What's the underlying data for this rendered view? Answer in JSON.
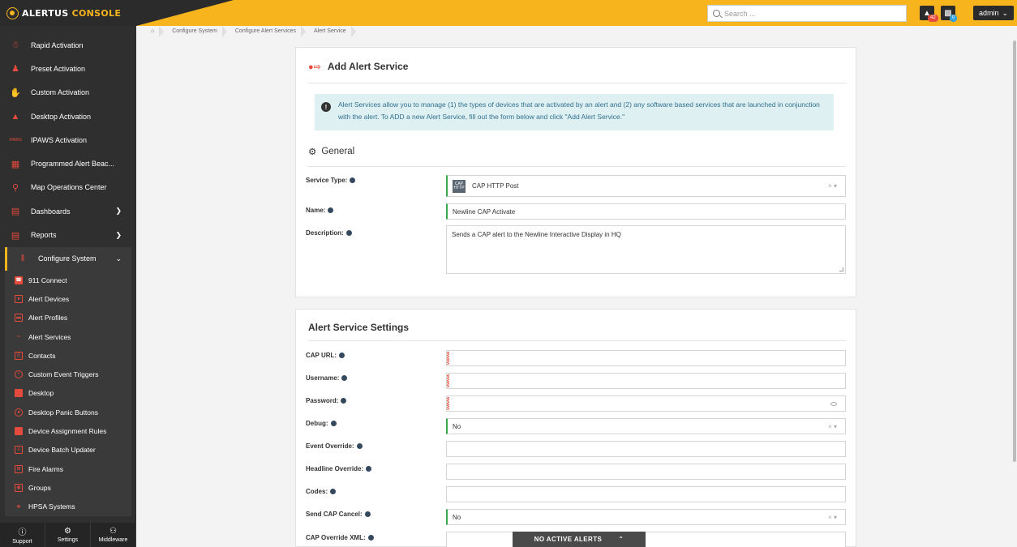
{
  "brand": {
    "name_a": "ALERTUS",
    "name_b": "CONSOLE"
  },
  "topbar": {
    "search_placeholder": "Search ...",
    "alerts_badge": "42",
    "users_badge": "0",
    "user_label": "admin"
  },
  "sidebar": {
    "items": [
      {
        "label": "Rapid Activation",
        "icon": "megaphone-icon"
      },
      {
        "label": "Preset Activation",
        "icon": "person-alert-icon"
      },
      {
        "label": "Custom Activation",
        "icon": "hand-icon"
      },
      {
        "label": "Desktop Activation",
        "icon": "desktop-alert-icon"
      },
      {
        "label": "IPAWS Activation",
        "icon": "ipaws-icon"
      },
      {
        "label": "Programmed Alert Beac...",
        "icon": "calendar-icon"
      },
      {
        "label": "Map Operations Center",
        "icon": "map-pin-icon"
      },
      {
        "label": "Dashboards",
        "icon": "dashboard-icon"
      },
      {
        "label": "Reports",
        "icon": "reports-icon"
      },
      {
        "label": "Configure System",
        "icon": "sliders-icon"
      }
    ],
    "sub_items": [
      "911 Connect",
      "Alert Devices",
      "Alert Profiles",
      "Alert Services",
      "Contacts",
      "Custom Event Triggers",
      "Desktop",
      "Desktop Panic Buttons",
      "Device Assignment Rules",
      "Device Batch Updater",
      "Fire Alarms",
      "Groups",
      "HPSA Systems"
    ],
    "footer": [
      "Support",
      "Settings",
      "Middleware"
    ]
  },
  "breadcrumb": [
    "Configure System",
    "Configure Alert Services",
    "Alert Service"
  ],
  "card1": {
    "title": "Add Alert Service",
    "info": "Alert Services allow you to manage (1) the types of devices that are activated by an alert and (2) any software based services that are launched in conjunction with the alert. To ADD a new Alert Service, fill out the form below and click \"Add Alert Service.\"",
    "section": "General",
    "service_type_label": "Service Type:",
    "service_type_value": "CAP HTTP Post",
    "cap_icon_text": "CAP HTTP",
    "name_label": "Name:",
    "name_value": "Newline CAP Activate",
    "description_label": "Description:",
    "description_value": "Sends a CAP alert to the Newline Interactive Display in HQ"
  },
  "card2": {
    "title": "Alert Service Settings",
    "fields": {
      "cap_url": "CAP URL:",
      "username": "Username:",
      "password": "Password:",
      "debug": "Debug:",
      "debug_value": "No",
      "event_override": "Event Override:",
      "headline_override": "Headline Override:",
      "codes": "Codes:",
      "send_cap_cancel": "Send CAP Cancel:",
      "send_cap_cancel_value": "No",
      "cap_override_xml": "CAP Override XML:"
    }
  },
  "alerts_bar": {
    "label": "NO ACTIVE ALERTS"
  },
  "colors": {
    "accent": "#f7b41d",
    "sidebar": "#2f2f2f",
    "info_bg": "#def0f1",
    "valid": "#3aa84b",
    "required": "#e74c3c"
  }
}
